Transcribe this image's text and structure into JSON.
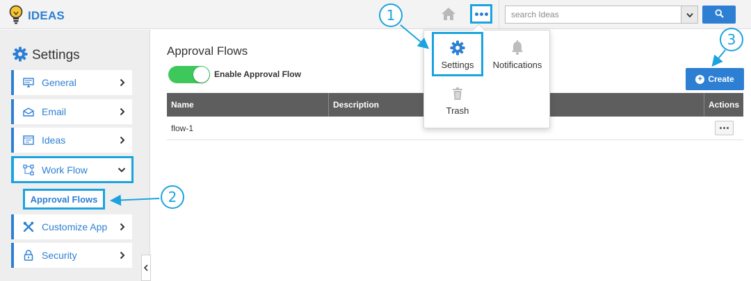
{
  "app": {
    "title": "IDEAS"
  },
  "topbar": {
    "search_placeholder": "search Ideas",
    "icons": {
      "home": "home-icon",
      "more": "more-dots-icon",
      "search": "search-icon",
      "dropdown": "caret-down-icon"
    }
  },
  "sidebar": {
    "title": "Settings",
    "items": [
      {
        "label": "General",
        "icon": "monitor-icon"
      },
      {
        "label": "Email",
        "icon": "envelope-icon"
      },
      {
        "label": "Ideas",
        "icon": "window-icon"
      },
      {
        "label": "Work Flow",
        "icon": "workflow-icon",
        "expanded": true
      },
      {
        "label": "Customize App",
        "icon": "tools-icon"
      },
      {
        "label": "Security",
        "icon": "lock-icon"
      }
    ],
    "subitem": {
      "label": "Approval Flows"
    }
  },
  "main": {
    "title": "Approval Flows",
    "toggle": {
      "label": "Enable Approval Flow",
      "on": true
    },
    "create_label": "Create",
    "table": {
      "headers": [
        "Name",
        "Description",
        "Actions"
      ],
      "rows": [
        {
          "name": "flow-1",
          "description": ""
        }
      ]
    }
  },
  "dropdown": {
    "items": [
      {
        "label": "Settings",
        "icon": "gear-icon"
      },
      {
        "label": "Notifications",
        "icon": "bell-icon"
      },
      {
        "label": "Trash",
        "icon": "trash-icon"
      }
    ]
  },
  "annotations": {
    "step1": "1",
    "step2": "2",
    "step3": "3"
  },
  "colors": {
    "accent": "#2d7fd3",
    "annotation": "#1aa3df",
    "toggle_on": "#3ec85c",
    "table_header": "#5e5e5e"
  }
}
